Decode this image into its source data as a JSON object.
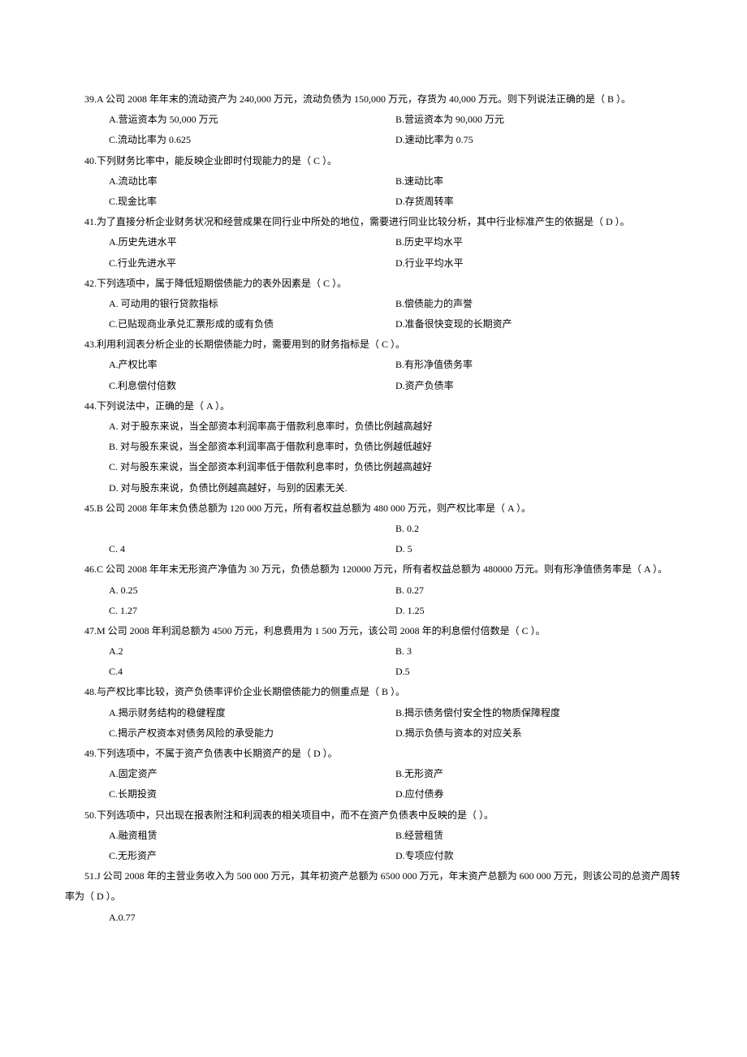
{
  "questions": [
    {
      "num": "39",
      "stem": "39.A 公司 2008 年年末的流动资产为 240,000 万元，流动负债为 150,000 万元，存货为 40,000 万元。则下列说法正确的是（ B  ）。",
      "options": [
        {
          "a": "A.营运资本为 50,000 万元",
          "b": "B.营运资本为 90,000 万元"
        },
        {
          "a": "C.流动比率为 0.625",
          "b": "D.速动比率为 0.75"
        }
      ]
    },
    {
      "num": "40",
      "stem": "40.下列财务比率中，能反映企业即时付现能力的是（  C ）。",
      "options": [
        {
          "a": "A.流动比率",
          "b": "B.速动比率"
        },
        {
          "a": "C.现金比率",
          "b": "D.存货周转率"
        }
      ]
    },
    {
      "num": "41",
      "stem": "41.为了直接分析企业财务状况和经营成果在同行业中所处的地位，需要进行同业比较分析，其中行业标准产生的依据是（ D  ）。",
      "options": [
        {
          "a": "A.历史先进水平",
          "b": "B.历史平均水平"
        },
        {
          "a": "C.行业先进水平",
          "b": "D.行业平均水平"
        }
      ]
    },
    {
      "num": "42",
      "stem": "42.下列选项中，属于降低短期偿债能力的表外因素是（  C  ）。",
      "options": [
        {
          "a": "A. 可动用的银行贷款指标",
          "b": "B.偿债能力的声誉"
        },
        {
          "a": "C.已贴现商业承兑汇票形成的或有负债",
          "b": "D.准备很快变现的长期资产"
        }
      ]
    },
    {
      "num": "43",
      "stem": "43.利用利润表分析企业的长期偿债能力时，需要用到的财务指标是（  C  ）。",
      "options": [
        {
          "a": "A.产权比率",
          "b": "B.有形净值债务率"
        },
        {
          "a": "C.利息偿付倍数",
          "b": "D.资产负债率"
        }
      ]
    },
    {
      "num": "44",
      "stem": "44.下列说法中，正确的是（  A  ）。",
      "single_options": [
        "A. 对于股东来说，当全部资本利润率高于借款利息率时，负债比例越高越好",
        "B. 对与股东来说，当全部资本利润率高于借款利息率时，负债比例越低越好",
        "C. 对与股东来说，当全部资本利润率低于借款利息率时，负债比例越高越好",
        "D. 对与股东来说，负债比例越高越好，与别的因素无关."
      ]
    },
    {
      "num": "45",
      "stem": "45.B 公司 2008 年年末负债总额为 120 000 万元，所有者权益总额为 480 000 万元，则产权比率是（  A  ）。",
      "options": [
        {
          "a": "",
          "b": "B. 0.2"
        },
        {
          "a": "C. 4",
          "b": "D. 5"
        }
      ]
    },
    {
      "num": "46",
      "stem": "46.C 公司 2008 年年末无形资产净值为 30 万元，负债总额为 120000 万元，所有者权益总额为 480000 万元。则有形净值债务率是（  A ）。",
      "options": [
        {
          "a": "A. 0.25",
          "b": "B. 0.27"
        },
        {
          "a": "C. 1.27",
          "b": "D. 1.25"
        }
      ]
    },
    {
      "num": "47",
      "stem": "47.M 公司 2008 年利润总额为 4500 万元，利息费用为 1 500 万元，该公司 2008 年的利息偿付倍数是（ C  ）。",
      "options": [
        {
          "a": "A.2",
          "b": "B. 3"
        },
        {
          "a": "C.4",
          "b": "D.5"
        }
      ]
    },
    {
      "num": "48",
      "stem": "48.与产权比率比较，资产负债率评价企业长期偿债能力的侧重点是（   B ）。",
      "options": [
        {
          "a": "A.揭示财务结构的稳健程度",
          "b": "B.揭示债务偿付安全性的物质保障程度"
        },
        {
          "a": "C.揭示产权资本对债务风险的承受能力",
          "b": "D.揭示负债与资本的对应关系"
        }
      ]
    },
    {
      "num": "49",
      "stem": "49.下列选项中，不属于资产负债表中长期资产的是（  D  ）。",
      "options": [
        {
          "a": "A.固定资产",
          "b": "B.无形资产"
        },
        {
          "a": "C.长期投资",
          "b": "D.应付债券"
        }
      ]
    },
    {
      "num": "50",
      "stem": "50.下列选项中，只出现在报表附注和利润表的相关项目中，而不在资产负债表中反映的是（    ）。",
      "options": [
        {
          "a": "A.融资租赁",
          "b": "B.经营租赁"
        },
        {
          "a": "C.无形资产",
          "b": "D.专项应付款"
        }
      ]
    },
    {
      "num": "51",
      "stem": "51.J 公司 2008 年的主营业务收入为 500 000 万元，其年初资产总额为 6500 000 万元，年末资产总额为 600 000 万元，则该公司的总资产周转率为（  D  ）。",
      "single_options": [
        "A.0.77"
      ]
    }
  ]
}
